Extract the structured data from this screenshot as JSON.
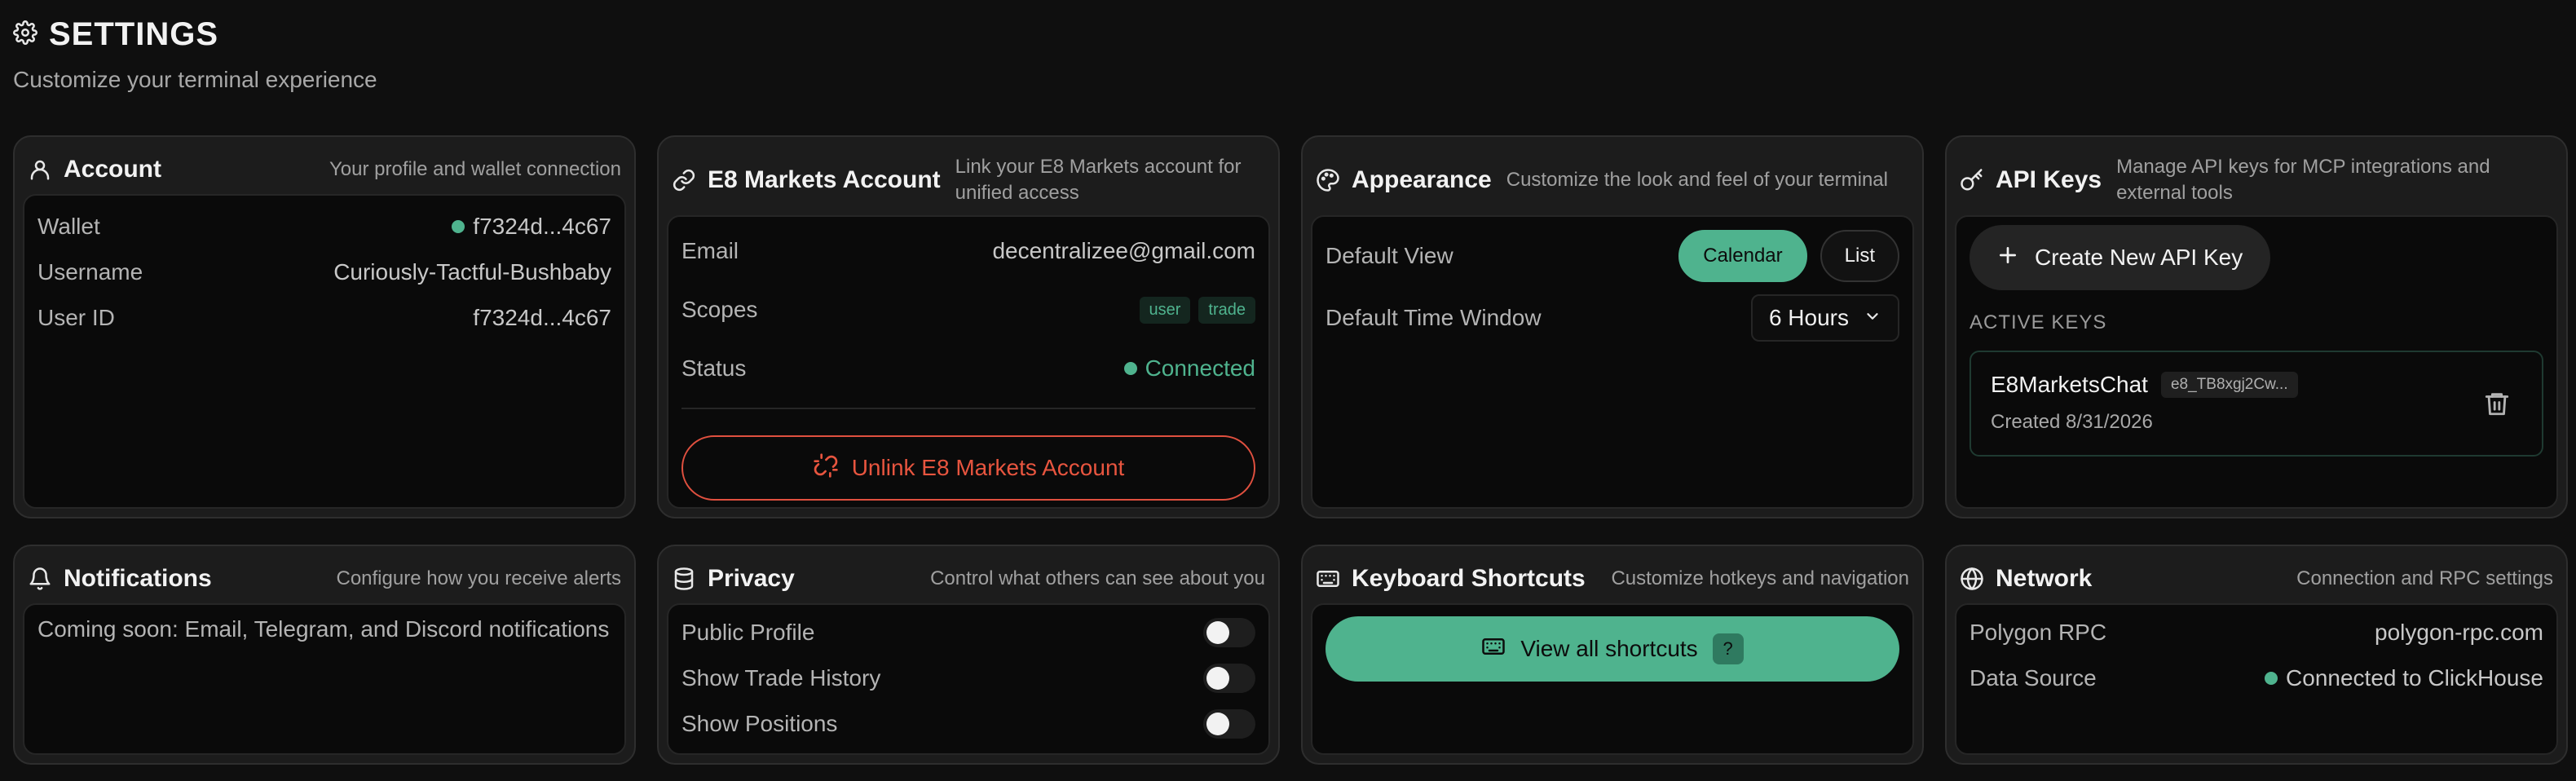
{
  "header": {
    "title": "SETTINGS",
    "subtitle": "Customize your terminal experience",
    "icon": "gear-icon"
  },
  "account": {
    "title": "Account",
    "description": "Your profile and wallet connection",
    "icon": "user-icon",
    "rows": [
      {
        "label": "Wallet",
        "value": "f7324d...4c67"
      },
      {
        "label": "Username",
        "value": "Curiously-Tactful-Bushbaby"
      },
      {
        "label": "User ID",
        "value": "f7324d...4c67"
      }
    ]
  },
  "e8": {
    "title": "E8 Markets Account",
    "description": "Link your E8 Markets account for unified access",
    "icon": "link-icon",
    "email_label": "Email",
    "email_value": "decentralizee@gmail.com",
    "scopes_label": "Scopes",
    "scopes": [
      "user",
      "trade"
    ],
    "status_label": "Status",
    "status_value": "Connected",
    "unlink_label": "Unlink E8 Markets Account",
    "accent_danger": "#e0503f"
  },
  "appearance": {
    "title": "Appearance",
    "description": "Customize the look and feel of your terminal",
    "icon": "palette-icon",
    "default_view_label": "Default View",
    "view_options": [
      "Calendar",
      "List"
    ],
    "selected_view": "Calendar",
    "time_window_label": "Default Time Window",
    "time_window_value": "6 Hours"
  },
  "api_keys": {
    "title": "API Keys",
    "description": "Manage API keys for MCP integrations and external tools",
    "icon": "key-icon",
    "create_label": "Create New API Key",
    "active_label": "ACTIVE KEYS",
    "keys": [
      {
        "name": "E8MarketsChat",
        "prefix": "e8_TB8xgj2Cw...",
        "created": "Created 8/31/2026"
      }
    ]
  },
  "notifications": {
    "title": "Notifications",
    "description": "Configure how you receive alerts",
    "icon": "bell-icon",
    "message": "Coming soon: Email, Telegram, and Discord notifications"
  },
  "privacy": {
    "title": "Privacy",
    "description": "Control what others can see about you",
    "icon": "database-icon",
    "toggles": [
      {
        "label": "Public Profile",
        "on": false
      },
      {
        "label": "Show Trade History",
        "on": false
      },
      {
        "label": "Show Positions",
        "on": false
      }
    ]
  },
  "shortcuts": {
    "title": "Keyboard Shortcuts",
    "description": "Customize hotkeys and navigation",
    "icon": "keyboard-icon",
    "button_label": "View all shortcuts",
    "key_hint": "?"
  },
  "network": {
    "title": "Network",
    "description": "Connection and RPC settings",
    "icon": "globe-icon",
    "rpc_label": "Polygon RPC",
    "rpc_value": "polygon-rpc.com",
    "source_label": "Data Source",
    "source_value": "Connected to ClickHouse"
  },
  "colors": {
    "accent": "#4fb38e",
    "danger": "#e0503f",
    "background": "#0f0f0f",
    "card": "#1c1c1c"
  }
}
